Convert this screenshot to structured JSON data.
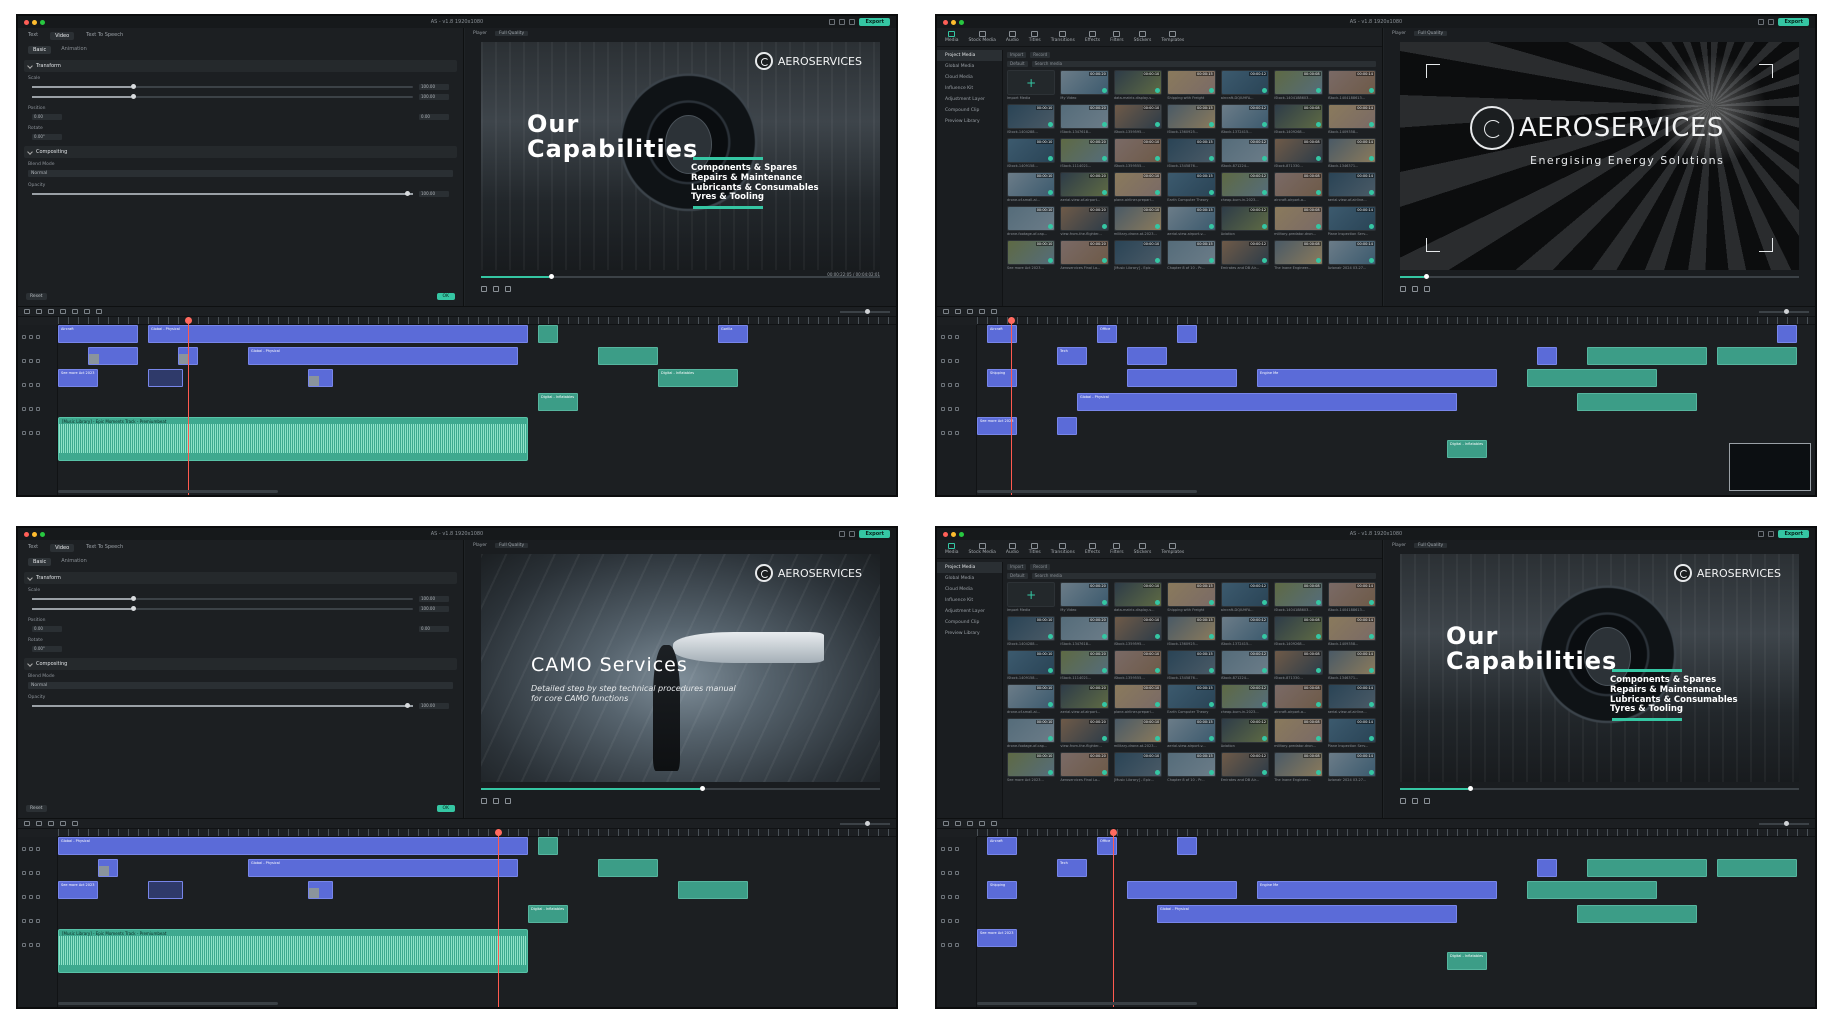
{
  "app": {
    "window_title": "AS - v1.8 1920x1080",
    "export_label": "Export"
  },
  "props_panel": {
    "tabs": [
      "Text",
      "Video",
      "Text To Speech"
    ],
    "subtabs": [
      "Basic",
      "Animation"
    ],
    "transform_label": "Transform",
    "scale_label": "Scale",
    "position_label": "Position",
    "rotate_label": "Rotate",
    "compositing_label": "Compositing",
    "blend_mode_label": "Blend Mode",
    "blend_mode_value": "Normal",
    "opacity_label": "Opacity",
    "scale_x": "100.00",
    "scale_y": "100.00",
    "pos_x": "0.00",
    "pos_y": "0.00",
    "rotate_value": "0.00°",
    "opacity_value": "100.00",
    "reset_label": "Reset",
    "ok_label": "OK",
    "scale_progress": 0.26,
    "opacity_progress": 1.0
  },
  "media_panel": {
    "toolbar": [
      "Media",
      "Stock Media",
      "Audio",
      "Titles",
      "Transitions",
      "Effects",
      "Filters",
      "Stickers",
      "Templates"
    ],
    "sidebar": [
      "Project Media",
      "Global Media",
      "Cloud Media",
      "Influence Kit",
      "Adjustment Layer",
      "Compound Clip",
      "Preview Library"
    ],
    "import_label": "Import",
    "record_label": "Record",
    "default_label": "Default",
    "search_placeholder": "Search media",
    "import_media_label": "Import Media",
    "thumb_labels": [
      "Import Media",
      "My Video",
      "data-matrix-display-s...",
      "Shipping with Freight",
      "aircraft-DQIUHFA...",
      "iStock-1404188603...",
      "iStock-1404188613...",
      "iStock-1404288...",
      "iStock-1347618...",
      "iStock-1359595...",
      "iStock-1360925...",
      "iStock-1372415...",
      "iStock-1409268...",
      "iStock-1409358...",
      "iStock-1409158...",
      "iStock-1114021...",
      "iStock-1359555...",
      "iStock-1345876...",
      "iStock-871224...",
      "iStock-871330...",
      "iStock-1346371...",
      "drone-of-small-ai...",
      "aerial-view-of-airport...",
      "plane-airliner-prepari...",
      "Earth Computer Theory",
      "cheap-burn-in-2023...",
      "aircraft-airport-a...",
      "aerial-view-of-airline...",
      "drone-footage-of-cap...",
      "view-from-the-flighter...",
      "military-drone-at-2023...",
      "aerial-view-airport-v...",
      "Aviation",
      "military-predator-dron...",
      "Plane Inspection Serv...",
      "See more Act 2023...",
      "Aeroservices Final Lo...",
      "[Music Library] - Epic...",
      "Chapter 8 of 10 - Pr...",
      "Emirates and DB Air...",
      "The Inane Engineer...",
      "Avionair 2024 03-27..."
    ],
    "thumb_durations": [
      "00:00:10",
      "00:00:20",
      "00:00:10",
      "00:00:15",
      "00:00:12",
      "00:00:08",
      "00:00:14"
    ]
  },
  "player": {
    "label": "Player",
    "quality": "Full Quality",
    "time_current": "00:00:22:05",
    "time_total": "00:04:02:01",
    "progress_1": 0.17,
    "progress_2": 0.06,
    "progress_3": 0.55,
    "progress_4": 0.17
  },
  "scenes": {
    "brand": "AEROSERVICES",
    "tagline": "Energising Energy Solutions",
    "cap_title_1": "Our",
    "cap_title_2": "Capabilities",
    "cap_items": [
      "Components & Spares",
      "Repairs & Maintenance",
      "Lubricants & Consumables",
      "Tyres & Tooling"
    ],
    "camo_title": "CAMO Services",
    "camo_sub_1": "Detailed step by step technical procedures manual",
    "camo_sub_2": "for core CAMO functions"
  },
  "timeline": {
    "audio_label": "[Music Library] - Epic Moments Track - Premiumbeat",
    "clip_labels": [
      "Gorilla",
      "Global - Physical",
      "Kosovo",
      "Digital - Inflatables",
      "See more Act 2023",
      "Aircraft",
      "Office",
      "Tech",
      "Shipping",
      "Repair",
      "Engine Me",
      "Aircraft Main",
      "Cargo",
      "Inspection"
    ]
  },
  "colors": {
    "accent": "#35c6a3",
    "clip_blue": "#5b6bd8",
    "clip_green": "#3c9d87",
    "playhead": "#ff5a4f",
    "panel_bg": "#1f2326"
  },
  "icons": [
    "import-icon",
    "search-icon",
    "filter-icon",
    "grid-icon",
    "play-icon",
    "stop-icon",
    "undo-icon",
    "redo-icon",
    "cut-icon",
    "zoom-icon"
  ]
}
